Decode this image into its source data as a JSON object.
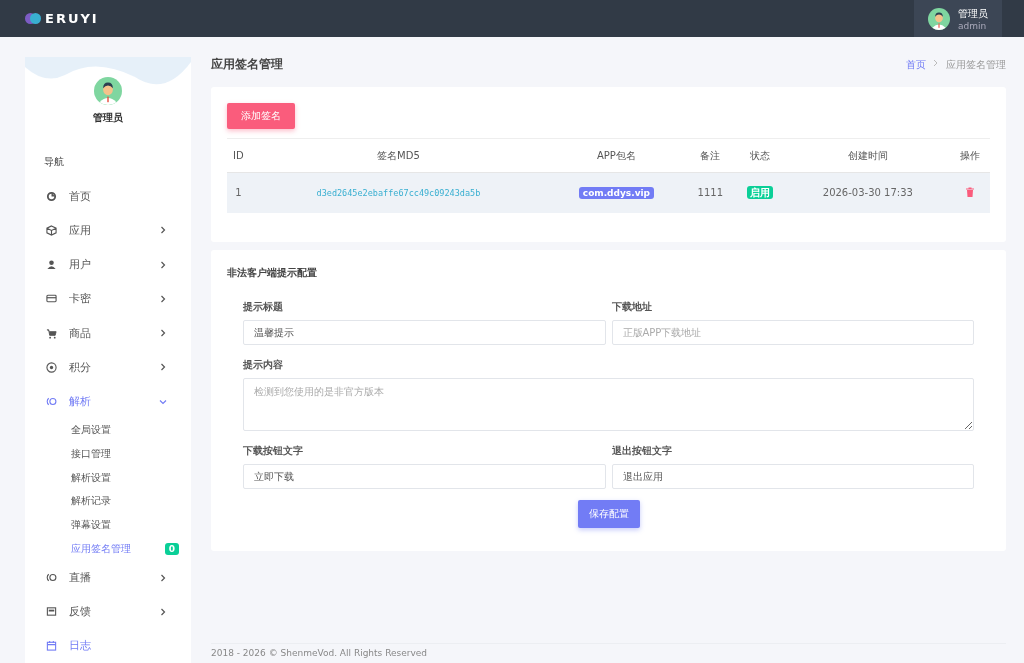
{
  "header": {
    "logo": "ERUYI",
    "user": {
      "name": "管理员",
      "role": "admin"
    }
  },
  "sidebar": {
    "user_name": "管理员",
    "section": "导航",
    "items": [
      {
        "label": "首页",
        "kind": "link",
        "selected": false
      },
      {
        "label": "应用",
        "kind": "menu",
        "expanded": false,
        "selected": false
      },
      {
        "label": "用户",
        "kind": "menu",
        "expanded": false,
        "selected": false
      },
      {
        "label": "卡密",
        "kind": "menu",
        "expanded": false,
        "selected": false
      },
      {
        "label": "商品",
        "kind": "menu",
        "expanded": false,
        "selected": false
      },
      {
        "label": "积分",
        "kind": "menu",
        "expanded": false,
        "selected": false
      },
      {
        "label": "解析",
        "kind": "menu",
        "expanded": true,
        "selected": true,
        "children": [
          {
            "label": "全局设置",
            "selected": false
          },
          {
            "label": "接口管理",
            "selected": false
          },
          {
            "label": "解析设置",
            "selected": false
          },
          {
            "label": "解析记录",
            "selected": false
          },
          {
            "label": "弹幕设置",
            "selected": false
          },
          {
            "label": "应用签名管理",
            "selected": true,
            "badge": "0"
          }
        ]
      },
      {
        "label": "直播",
        "kind": "menu",
        "expanded": false,
        "selected": false
      },
      {
        "label": "反馈",
        "kind": "menu",
        "expanded": false,
        "selected": false
      },
      {
        "label": "日志",
        "kind": "link",
        "selected": true
      }
    ]
  },
  "page": {
    "title": "应用签名管理",
    "breadcrumb": [
      "首页",
      "应用签名管理"
    ]
  },
  "signatures": {
    "add_button": "添加签名",
    "columns": [
      "ID",
      "签名MD5",
      "APP包名",
      "备注",
      "状态",
      "创建时间",
      "操作"
    ],
    "rows": [
      {
        "id": "1",
        "md5": "d3ed2645e2ebaffe67cc49c09243da5b",
        "package": "com.ddys.vip",
        "note": "1111",
        "status": "启用",
        "enabled": true,
        "created": "2026-03-30 17:33"
      }
    ]
  },
  "config": {
    "title": "非法客户端提示配置",
    "fields": [
      {
        "label": "提示标题",
        "kind": "input",
        "value": "温馨提示"
      },
      {
        "label": "下载地址",
        "kind": "input",
        "placeholder": "正版APP下载地址"
      },
      {
        "label": "提示内容",
        "kind": "textarea",
        "placeholder": "检测到您使用的是非官方版本"
      },
      {
        "label": "下载按钮文字",
        "kind": "input",
        "value": "立即下载"
      },
      {
        "label": "退出按钮文字",
        "kind": "input",
        "value": "退出应用"
      }
    ],
    "save_button": "保存配置"
  },
  "footer": "2018 - 2026 © ShenmeVod. All Rights Reserved"
}
